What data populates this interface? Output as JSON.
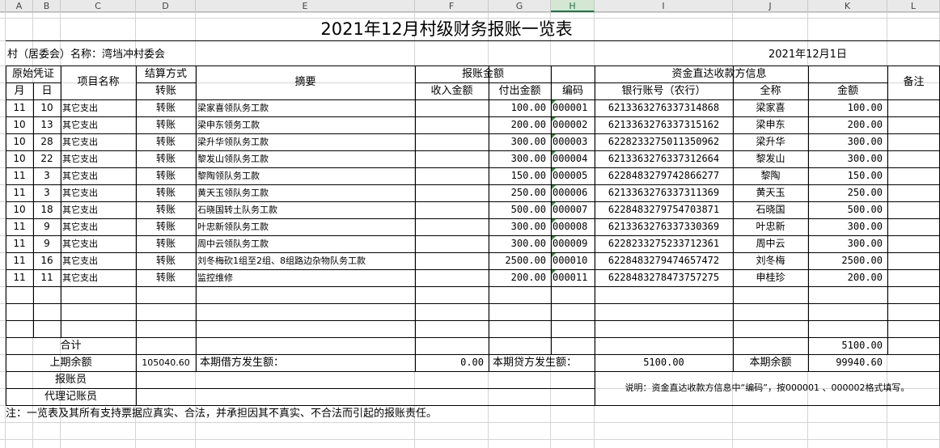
{
  "columns": [
    "A",
    "B",
    "C",
    "D",
    "E",
    "F",
    "G",
    "H",
    "I",
    "J",
    "K",
    "L"
  ],
  "title": "2021年12月村级财务报账一览表",
  "village_label": "村（居委会）名称：湾垱冲村委会",
  "date": "2021年12月1日",
  "headers": {
    "original_voucher": "原始凭证",
    "month": "月",
    "day": "日",
    "item_name": "项目名称",
    "settlement": "结算方式",
    "transfer": "转账",
    "summary": "摘要",
    "amount_group": "报账金额",
    "income": "收入金额",
    "payment": "付出金额",
    "payee_info": "资金直达收款方信息",
    "code": "编码",
    "bank_account": "银行账号（农行）",
    "full_name": "全称",
    "amount": "金额",
    "remarks": "备注"
  },
  "rows": [
    {
      "m": "11",
      "d": "10",
      "item": "其它支出",
      "settle": "转账",
      "summary": "梁家喜领队务工款",
      "pay": "100.00",
      "code": "000001",
      "account": "6213363276337314868",
      "name": "梁家喜",
      "amount": "100.00"
    },
    {
      "m": "10",
      "d": "13",
      "item": "其它支出",
      "settle": "转账",
      "summary": "梁申东领务工款",
      "pay": "200.00",
      "code": "000002",
      "account": "6213363276337315162",
      "name": "梁申东",
      "amount": "200.00"
    },
    {
      "m": "10",
      "d": "28",
      "item": "其它支出",
      "settle": "转账",
      "summary": "梁升华领队务工款",
      "pay": "300.00",
      "code": "000003",
      "account": "6228233275011350962",
      "name": "梁升华",
      "amount": "300.00"
    },
    {
      "m": "10",
      "d": "22",
      "item": "其它支出",
      "settle": "转账",
      "summary": "黎发山领队务工款",
      "pay": "300.00",
      "code": "000004",
      "account": "6213363276337312664",
      "name": "黎发山",
      "amount": "300.00"
    },
    {
      "m": "11",
      "d": "3",
      "item": "其它支出",
      "settle": "转账",
      "summary": "黎陶领队务工款",
      "pay": "150.00",
      "code": "000005",
      "account": "6228483279742866277",
      "name": "黎陶",
      "amount": "150.00"
    },
    {
      "m": "11",
      "d": "3",
      "item": "其它支出",
      "settle": "转账",
      "summary": "黄天玉领队务工款",
      "pay": "250.00",
      "code": "000006",
      "account": "6213363276337311369",
      "name": "黄天玉",
      "amount": "250.00"
    },
    {
      "m": "10",
      "d": "18",
      "item": "其它支出",
      "settle": "转账",
      "summary": "石晓国转土队务工款",
      "pay": "500.00",
      "code": "000007",
      "account": "6228483279754703871",
      "name": "石晓国",
      "amount": "500.00"
    },
    {
      "m": "11",
      "d": "9",
      "item": "其它支出",
      "settle": "转账",
      "summary": "叶忠新领队务工款",
      "pay": "300.00",
      "code": "000008",
      "account": "6213363276337330369",
      "name": "叶忠新",
      "amount": "300.00"
    },
    {
      "m": "11",
      "d": "9",
      "item": "其它支出",
      "settle": "转账",
      "summary": "周中云领队务工款",
      "pay": "300.00",
      "code": "000009",
      "account": "6228233275233712361",
      "name": "周中云",
      "amount": "300.00"
    },
    {
      "m": "11",
      "d": "16",
      "item": "其它支出",
      "settle": "转账",
      "summary": "刘冬梅砍1组至2组、8组路边杂物队务工款",
      "pay": "2500.00",
      "code": "000010",
      "account": "6228483279474657472",
      "name": "刘冬梅",
      "amount": "2500.00"
    },
    {
      "m": "11",
      "d": "11",
      "item": "其它支出",
      "settle": "转账",
      "summary": "监控维修",
      "pay": "200.00",
      "code": "000011",
      "account": "6228483278473757275",
      "name": "申桂珍",
      "amount": "200.00"
    }
  ],
  "totals": {
    "label": "合计",
    "amount": "5100.00",
    "prev_balance_label": "上期余额",
    "prev_balance": "105040.60",
    "debit_label": "本期借方发生额：",
    "debit": "0.00",
    "credit_label": "本期贷方发生额：",
    "credit": "5100.00",
    "balance_label": "本期余额",
    "balance": "99940.60"
  },
  "reporter_label": "报账员",
  "agent_label": "代理记账员",
  "note_right": "说明：资金直达收款方信息中“编码”，按000001 、000002格式填写。",
  "footnote": "注：一览表及其所有支持票据应真实、合法，并承担因其不真实、不合法而引起的报账责任。"
}
